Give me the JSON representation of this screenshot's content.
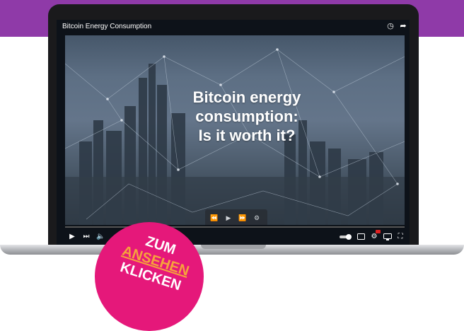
{
  "video": {
    "window_title": "Bitcoin Energy Consumption",
    "headline_lines": [
      "Bitcoin energy",
      "consumption:",
      "Is it worth it?"
    ]
  },
  "sticker": {
    "lines": [
      "ZUM",
      "ANSEHEN",
      "KLICKEN"
    ],
    "background": "#e5187a",
    "accent": "#f6a23c"
  },
  "banner_color": "#8f3aa8",
  "icons": {
    "title_bar": [
      "clock-icon",
      "share-icon"
    ],
    "player_left": [
      "play-icon",
      "skip-next-icon",
      "volume-icon"
    ],
    "player_right": [
      "autoplay-toggle-icon",
      "subtitles-icon",
      "settings-icon",
      "cast-icon",
      "fullscreen-icon"
    ],
    "overlay": [
      "rewind-icon",
      "play-icon",
      "fast-forward-icon",
      "settings-icon"
    ]
  }
}
